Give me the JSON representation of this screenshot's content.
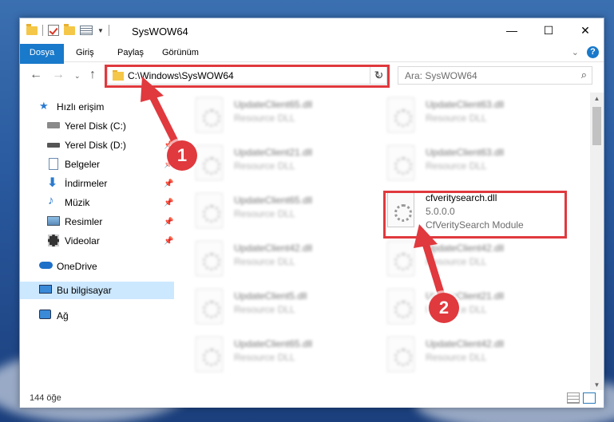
{
  "window": {
    "title": "SysWOW64",
    "controls": {
      "minimize": "—",
      "maximize": "☐",
      "close": "✕"
    }
  },
  "ribbon": {
    "tabs": [
      "Dosya",
      "Giriş",
      "Paylaş",
      "Görünüm"
    ],
    "help": "?"
  },
  "navigation": {
    "address_path": "C:\\Windows\\SysWOW64",
    "search_placeholder": "Ara: SysWOW64"
  },
  "sidebar": {
    "items": [
      {
        "label": "Hızlı erişim",
        "icon": "star-icon",
        "pinned": false
      },
      {
        "label": "Yerel Disk (C:)",
        "icon": "drive-icon",
        "pinned": false
      },
      {
        "label": "Yerel Disk (D:)",
        "icon": "drive-icon",
        "pinned": true
      },
      {
        "label": "Belgeler",
        "icon": "documents-icon",
        "pinned": true
      },
      {
        "label": "İndirmeler",
        "icon": "download-icon",
        "pinned": true
      },
      {
        "label": "Müzik",
        "icon": "music-icon",
        "pinned": true
      },
      {
        "label": "Resimler",
        "icon": "pictures-icon",
        "pinned": true
      },
      {
        "label": "Videolar",
        "icon": "video-icon",
        "pinned": true
      },
      {
        "label": "OneDrive",
        "icon": "cloud-icon",
        "pinned": false
      },
      {
        "label": "Bu bilgisayar",
        "icon": "computer-icon",
        "pinned": false
      },
      {
        "label": "Ağ",
        "icon": "network-icon",
        "pinned": false
      }
    ]
  },
  "files": {
    "left_column": [
      {
        "name": "UpdateClient65.dll",
        "desc": "Resource DLL"
      },
      {
        "name": "UpdateClient21.dll",
        "desc": "Resource DLL"
      },
      {
        "name": "UpdateClient65.dll",
        "desc": "Resource DLL"
      },
      {
        "name": "UpdateClient42.dll",
        "desc": "Resource DLL"
      },
      {
        "name": "UpdateClient5.dll",
        "desc": "Resource DLL"
      },
      {
        "name": "UpdateClient65.dll",
        "desc": "Resource DLL"
      }
    ],
    "right_column": [
      {
        "name": "UpdateClient63.dll",
        "desc": "Resource DLL"
      },
      {
        "name": "UpdateClient63.dll",
        "desc": "Resource DLL"
      },
      {
        "name": "UpdateClient42.dll",
        "desc": "Resource DLL"
      },
      {
        "name": "UpdateClient21.dll",
        "desc": "Resource DLL"
      },
      {
        "name": "UpdateClient42.dll",
        "desc": "Resource DLL"
      }
    ],
    "highlighted": {
      "name": "cfveritysearch.dll",
      "version": "5.0.0.0",
      "desc": "CfVeritySearch Module"
    }
  },
  "status": {
    "item_count": "144 öğe"
  },
  "callouts": {
    "step1": "1",
    "step2": "2"
  },
  "colors": {
    "accent": "#1979ca",
    "highlight": "#e0393e",
    "selection": "#cce8ff"
  }
}
